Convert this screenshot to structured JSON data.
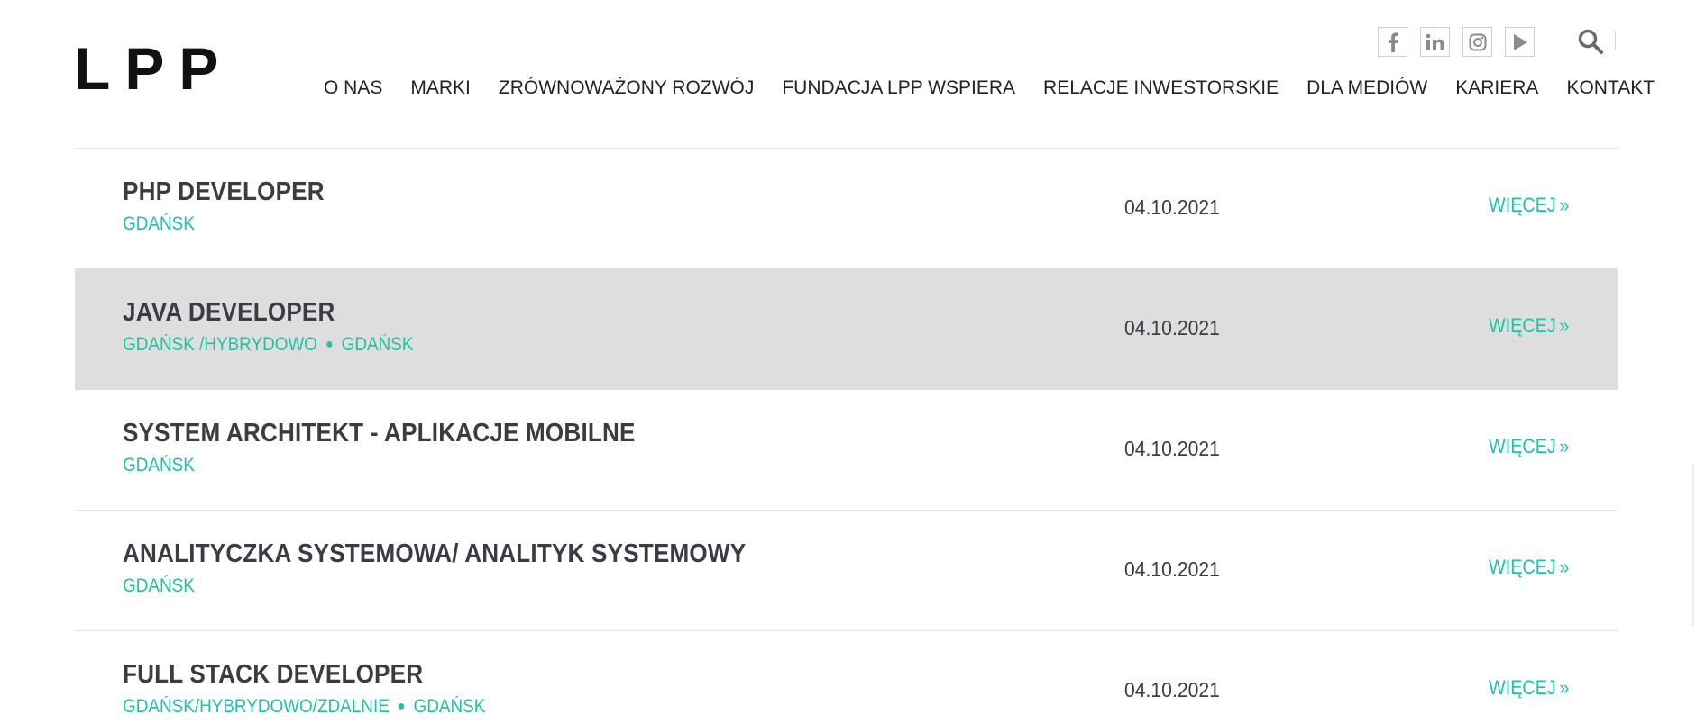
{
  "brand": {
    "logo_letters": [
      "L",
      "P",
      "P"
    ]
  },
  "header": {
    "social": [
      {
        "icon": "facebook-icon",
        "glyph": "f"
      },
      {
        "icon": "linkedin-icon",
        "glyph": "in"
      },
      {
        "icon": "instagram-icon",
        "glyph": ""
      },
      {
        "icon": "youtube-icon",
        "glyph": ""
      }
    ],
    "search_icon": "search-icon",
    "nav": [
      "O NAS",
      "MARKI",
      "ZRÓWNOWAŻONY ROZWÓJ",
      "FUNDACJA LPP WSPIERA",
      "RELACJE INWESTORSKIE",
      "DLA MEDIÓW",
      "KARIERA",
      "KONTAKT"
    ]
  },
  "colors": {
    "accent": "#1ec3a6",
    "text": "#3b3b46",
    "highlight_row": "#dedede"
  },
  "jobs": [
    {
      "title": "PHP DEVELOPER",
      "locations": [
        "GDAŃSK"
      ],
      "date": "04.10.2021",
      "more": "WIĘCEJ",
      "highlighted": false
    },
    {
      "title": "JAVA DEVELOPER",
      "locations": [
        "GDAŃSK /HYBRYDOWO",
        "GDAŃSK"
      ],
      "date": "04.10.2021",
      "more": "WIĘCEJ",
      "highlighted": true
    },
    {
      "title": "SYSTEM ARCHITEKT - APLIKACJE MOBILNE",
      "locations": [
        "GDAŃSK"
      ],
      "date": "04.10.2021",
      "more": "WIĘCEJ",
      "highlighted": false
    },
    {
      "title": "ANALITYCZKA SYSTEMOWA/ ANALITYK SYSTEMOWY",
      "locations": [
        "GDAŃSK"
      ],
      "date": "04.10.2021",
      "more": "WIĘCEJ",
      "highlighted": false
    },
    {
      "title": "FULL STACK DEVELOPER",
      "locations": [
        "GDAŃSK/HYBRYDOWO/ZDALNIE",
        "GDAŃSK"
      ],
      "date": "04.10.2021",
      "more": "WIĘCEJ",
      "highlighted": false
    }
  ]
}
